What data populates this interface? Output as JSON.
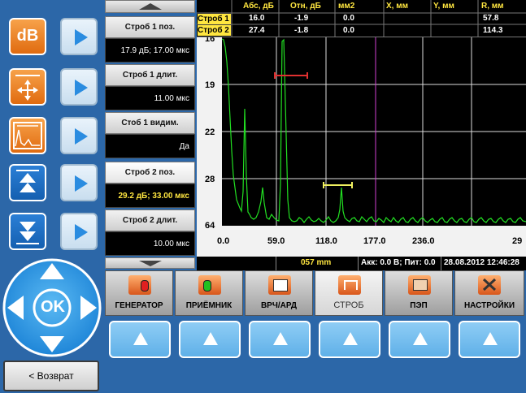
{
  "menu": {
    "items": [
      {
        "label": "Строб 1 поз.",
        "value": "17.9 дБ; 17.00 мкс"
      },
      {
        "label": "Строб 1 длит.",
        "value": "11.00 мкс"
      },
      {
        "label": "Стоб 1 видим.",
        "value": "Да"
      },
      {
        "label": "Строб 2 поз.",
        "value": "29.2 дБ; 33.00 мкс"
      },
      {
        "label": "Строб 2 длит.",
        "value": "10.00 мкс"
      }
    ]
  },
  "table": {
    "headers": [
      "Абс, дБ",
      "Отн, дБ",
      "мм2",
      "X, мм",
      "Y, мм",
      "R, мм"
    ],
    "rows": [
      {
        "name": "Строб 1",
        "abs": "16.0",
        "otn": "-1.9",
        "mm2": "0.0",
        "x": "",
        "y": "",
        "r": "57.8"
      },
      {
        "name": "Строб 2",
        "abs": "27.4",
        "otn": "-1.8",
        "mm2": "0.0",
        "x": "",
        "y": "",
        "r": "114.3"
      }
    ]
  },
  "chart_data": {
    "type": "line",
    "y_ticks": [
      "16",
      "19",
      "22",
      "28",
      "64"
    ],
    "x_ticks": [
      "0.0",
      "59.0",
      "118.0",
      "177.0",
      "236.0",
      "29"
    ],
    "series": [
      {
        "color": "#22e022"
      }
    ],
    "gates": [
      {
        "color": "#e03030",
        "level_label": "19"
      },
      {
        "color": "#f0f060",
        "level_label": "28"
      }
    ],
    "grid": true
  },
  "status": {
    "distance": "057 mm",
    "battery": "Акк: 0.0 В; Пит: 0.0",
    "datetime": "28.08.2012 12:46:28"
  },
  "tabs": [
    {
      "label": "ГЕНЕРАТОР",
      "icon": "generator-icon"
    },
    {
      "label": "ПРИЁМНИК",
      "icon": "receiver-icon"
    },
    {
      "label": "ВРЧ/АРД",
      "icon": "vrch-icon"
    },
    {
      "label": "СТРОБ",
      "icon": "gate-icon"
    },
    {
      "label": "ПЭП",
      "icon": "probe-icon"
    },
    {
      "label": "НАСТРОЙКИ",
      "icon": "settings-icon"
    }
  ],
  "left": {
    "db_label": "dB",
    "ok_label": "OK",
    "back_label": "< Возврат"
  },
  "colors": {
    "background": "#2c67a8",
    "signal": "#22e022",
    "gate1": "#e03030",
    "gate2": "#f0f060",
    "marker": "#d040d0"
  }
}
